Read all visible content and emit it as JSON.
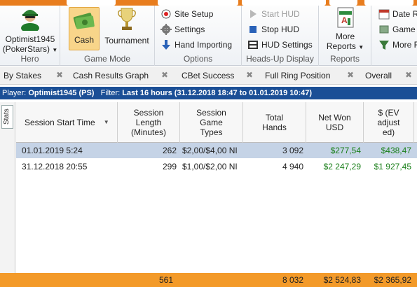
{
  "hero": {
    "name_line1": "Optimist1945",
    "name_line2": "(PokerStars)",
    "group_label": "Hero"
  },
  "game_mode": {
    "cash_label": "Cash",
    "tournament_label": "Tournament",
    "group_label": "Game Mode"
  },
  "options": {
    "site_setup": "Site Setup",
    "settings": "Settings",
    "hand_importing": "Hand Importing",
    "group_label": "Options"
  },
  "hud": {
    "start_hud": "Start HUD",
    "stop_hud": "Stop HUD",
    "hud_settings": "HUD Settings",
    "group_label": "Heads-Up Display"
  },
  "reports": {
    "more_label_1": "More",
    "more_label_2": "Reports",
    "group_label": "Reports"
  },
  "right_group": {
    "date_r": "Date R",
    "game_t": "Game T",
    "more_f": "More F"
  },
  "filter_tabs": [
    "By Stakes",
    "Cash Results Graph",
    "CBet Success",
    "Full Ring Position",
    "Overall"
  ],
  "player_filter": {
    "player_prefix": "Player:",
    "player_value": "Optimist1945 (PS)",
    "filter_prefix": "Filter:",
    "filter_value": "Last 16 hours (31.12.2018 18:47 to 01.01.2019 10:47)"
  },
  "side_tab_label": "Stats",
  "columns": {
    "start_time": "Session Start Time",
    "length_1": "Session",
    "length_2": "Length",
    "length_3": "(Minutes)",
    "types_1": "Session",
    "types_2": "Game",
    "types_3": "Types",
    "hands_1": "Total",
    "hands_2": "Hands",
    "netwon_1": "Net Won",
    "netwon_2": "USD",
    "ev_1": "$ (EV",
    "ev_2": "adjust",
    "ev_3": "ed)"
  },
  "rows": [
    {
      "start": "01.01.2019 5:24",
      "length": "262",
      "types": "$2,00/$4,00 NI",
      "hands": "3 092",
      "net": "$277,54",
      "ev": "$438,47"
    },
    {
      "start": "31.12.2018 20:55",
      "length": "299",
      "types": "$1,00/$2,00 NI",
      "hands": "4 940",
      "net": "$2 247,29",
      "ev": "$1 927,45"
    }
  ],
  "totals": {
    "length": "561",
    "hands": "8 032",
    "net": "$2 524,83",
    "ev": "$2 365,92"
  },
  "colors": {
    "accent_orange": "#f39a29",
    "header_blue": "#1b4f96",
    "positive_green": "#1a7f1a",
    "selected_row": "#c5d3e6"
  }
}
